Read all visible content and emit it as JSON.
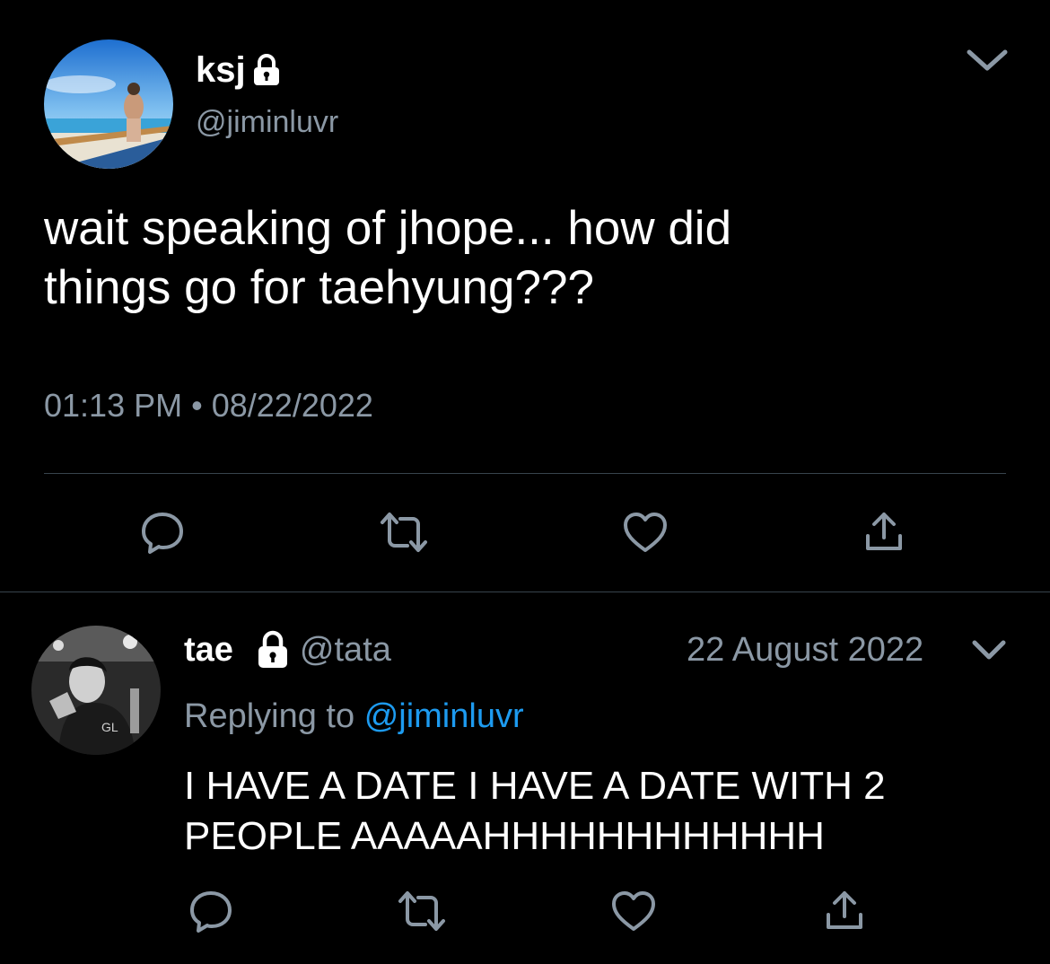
{
  "main_tweet": {
    "display_name": "ksj",
    "handle": "@jiminluvr",
    "text_line1": "wait speaking of jhope... how did",
    "text_line2": "things go for taehyung???",
    "time": "01:13 PM",
    "separator": "•",
    "date": "08/22/2022"
  },
  "reply_tweet": {
    "display_name": "tae",
    "handle": "@tata",
    "date": "22 August 2022",
    "replying_prefix": "Replying to",
    "replying_handle": "@jiminluvr",
    "text_line1": "I HAVE A DATE I HAVE A DATE WITH 2",
    "text_line2": "PEOPLE AAAAAHHHHHHHHHHHH"
  },
  "icons": {
    "lock": "lock-icon",
    "chevron": "chevron-down-icon",
    "reply": "reply-icon",
    "retweet": "retweet-icon",
    "like": "heart-icon",
    "share": "share-icon"
  },
  "colors": {
    "background": "#000000",
    "text": "#ffffff",
    "secondary": "#8b98a5",
    "link": "#1d9bf0",
    "divider": "#38444d"
  }
}
